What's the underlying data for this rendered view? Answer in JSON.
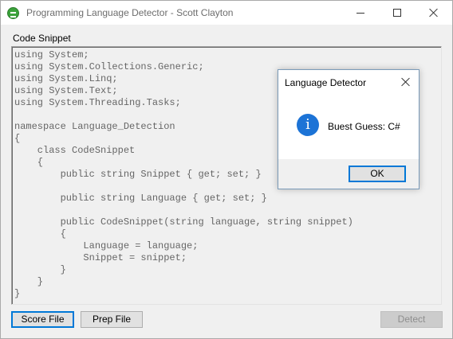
{
  "window": {
    "title": "Programming Language Detector - Scott Clayton",
    "icon": "app-logo-icon",
    "controls": [
      "minimize-icon",
      "maximize-icon",
      "close-icon"
    ]
  },
  "main": {
    "section_label": "Code Snippet",
    "code_lines": [
      "using System;",
      "using System.Collections.Generic;",
      "using System.Linq;",
      "using System.Text;",
      "using System.Threading.Tasks;",
      "",
      "namespace Language_Detection",
      "{",
      "    class CodeSnippet",
      "    {",
      "        public string Snippet { get; set; }",
      "",
      "        public string Language { get; set; }",
      "",
      "        public CodeSnippet(string language, string snippet)",
      "        {",
      "            Language = language;",
      "            Snippet = snippet;",
      "        }",
      "    }",
      "}"
    ]
  },
  "buttons": {
    "score_file": "Score File",
    "prep_file": "Prep File",
    "detect": "Detect"
  },
  "dialog": {
    "title": "Language Detector",
    "icon": "info-icon",
    "icon_glyph": "i",
    "message": "Buest Guess: C#",
    "ok": "OK"
  },
  "colors": {
    "accent": "#0078d7",
    "info_icon": "#1c73d6",
    "code_text": "#666666"
  }
}
